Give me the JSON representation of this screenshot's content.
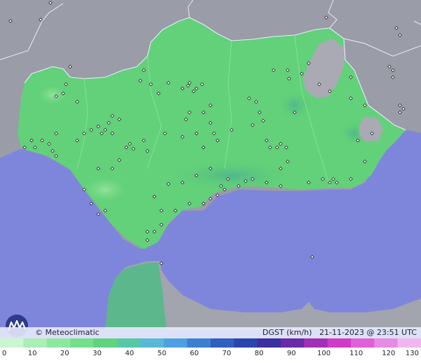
{
  "brand": "© Meteoclimatic",
  "info": {
    "variable": "DGST (km/h)",
    "datetime": "21-11-2023 @ 23:51 UTC"
  },
  "scale": {
    "ticks": [
      "0",
      "10",
      "20",
      "30",
      "40",
      "50",
      "60",
      "70",
      "80",
      "90",
      "100",
      "110",
      "120",
      "130"
    ],
    "colors": [
      "#c8f7d0",
      "#a9efb6",
      "#8ee79f",
      "#74df8a",
      "#61d37e",
      "#56c8a6",
      "#58b9d6",
      "#4ea1e0",
      "#3e7fd2",
      "#2f5fbf",
      "#2a46ad",
      "#3a2fa0",
      "#6b2aa8",
      "#a22fb8",
      "#d03cc6",
      "#e060d6",
      "#e98ae4",
      "#f2b6ef"
    ]
  },
  "stations": [
    [
      15,
      30
    ],
    [
      58,
      28
    ],
    [
      72,
      4
    ],
    [
      100,
      95
    ],
    [
      94,
      120
    ],
    [
      90,
      133
    ],
    [
      80,
      137
    ],
    [
      110,
      145
    ],
    [
      205,
      100
    ],
    [
      200,
      115
    ],
    [
      215,
      120
    ],
    [
      226,
      133
    ],
    [
      240,
      118
    ],
    [
      260,
      126
    ],
    [
      268,
      122
    ],
    [
      270,
      118
    ],
    [
      280,
      126
    ],
    [
      288,
      120
    ],
    [
      276,
      130
    ],
    [
      300,
      150
    ],
    [
      290,
      160
    ],
    [
      300,
      175
    ],
    [
      280,
      190
    ],
    [
      305,
      190
    ],
    [
      310,
      200
    ],
    [
      330,
      185
    ],
    [
      355,
      140
    ],
    [
      365,
      145
    ],
    [
      370,
      160
    ],
    [
      375,
      172
    ],
    [
      360,
      178
    ],
    [
      380,
      200
    ],
    [
      385,
      210
    ],
    [
      395,
      210
    ],
    [
      400,
      205
    ],
    [
      408,
      210
    ],
    [
      420,
      160
    ],
    [
      390,
      100
    ],
    [
      410,
      100
    ],
    [
      412,
      112
    ],
    [
      430,
      105
    ],
    [
      440,
      90
    ],
    [
      455,
      120
    ],
    [
      470,
      130
    ],
    [
      500,
      140
    ],
    [
      500,
      110
    ],
    [
      520,
      150
    ],
    [
      530,
      190
    ],
    [
      520,
      230
    ],
    [
      500,
      255
    ],
    [
      480,
      260
    ],
    [
      460,
      255
    ],
    [
      440,
      260
    ],
    [
      400,
      265
    ],
    [
      380,
      260
    ],
    [
      360,
      255
    ],
    [
      340,
      265
    ],
    [
      320,
      270
    ],
    [
      310,
      278
    ],
    [
      300,
      283
    ],
    [
      290,
      290
    ],
    [
      270,
      290
    ],
    [
      250,
      300
    ],
    [
      230,
      320
    ],
    [
      220,
      330
    ],
    [
      210,
      342
    ],
    [
      150,
      300
    ],
    [
      140,
      305
    ],
    [
      130,
      290
    ],
    [
      120,
      270
    ],
    [
      140,
      240
    ],
    [
      160,
      240
    ],
    [
      170,
      228
    ],
    [
      180,
      210
    ],
    [
      185,
      205
    ],
    [
      190,
      212
    ],
    [
      205,
      200
    ],
    [
      210,
      215
    ],
    [
      160,
      190
    ],
    [
      150,
      185
    ],
    [
      145,
      190
    ],
    [
      140,
      180
    ],
    [
      155,
      175
    ],
    [
      130,
      185
    ],
    [
      120,
      190
    ],
    [
      110,
      200
    ],
    [
      80,
      190
    ],
    [
      70,
      205
    ],
    [
      60,
      200
    ],
    [
      50,
      210
    ],
    [
      45,
      200
    ],
    [
      35,
      210
    ],
    [
      75,
      215
    ],
    [
      80,
      222
    ],
    [
      160,
      165
    ],
    [
      170,
      170
    ],
    [
      235,
      190
    ],
    [
      260,
      195
    ],
    [
      265,
      170
    ],
    [
      270,
      160
    ],
    [
      290,
      210
    ],
    [
      300,
      240
    ],
    [
      280,
      250
    ],
    [
      260,
      260
    ],
    [
      240,
      262
    ],
    [
      220,
      280
    ],
    [
      230,
      300
    ],
    [
      315,
      265
    ],
    [
      325,
      255
    ],
    [
      350,
      258
    ],
    [
      400,
      240
    ],
    [
      410,
      230
    ],
    [
      470,
      260
    ],
    [
      475,
      255
    ],
    [
      510,
      200
    ],
    [
      560,
      100
    ],
    [
      570,
      150
    ],
    [
      575,
      155
    ],
    [
      570,
      160
    ],
    [
      565,
      40
    ],
    [
      570,
      50
    ],
    [
      560,
      110
    ],
    [
      555,
      95
    ],
    [
      465,
      25
    ],
    [
      210,
      330
    ],
    [
      230,
      375
    ],
    [
      445,
      366
    ]
  ]
}
